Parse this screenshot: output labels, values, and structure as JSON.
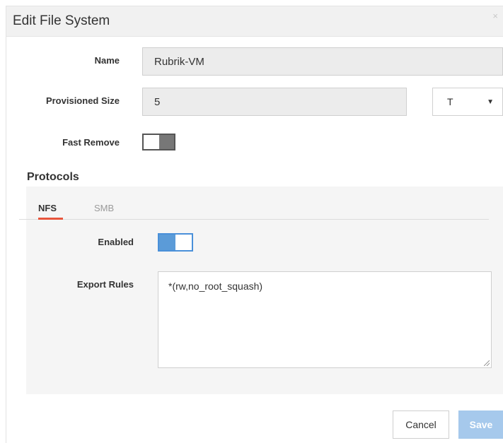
{
  "dialog": {
    "title": "Edit File System",
    "close_icon": "×"
  },
  "form": {
    "name_label": "Name",
    "name_value": "Rubrik-VM",
    "size_label": "Provisioned Size",
    "size_value": "5",
    "size_unit": "T",
    "fast_remove_label": "Fast Remove",
    "fast_remove_enabled": false
  },
  "protocols": {
    "title": "Protocols",
    "tabs": [
      {
        "label": "NFS",
        "active": true
      },
      {
        "label": "SMB",
        "active": false
      }
    ],
    "enabled_label": "Enabled",
    "enabled": true,
    "export_rules_label": "Export Rules",
    "export_rules_value": "*(rw,no_root_squash)"
  },
  "buttons": {
    "cancel": "Cancel",
    "save": "Save"
  },
  "colors": {
    "tab_accent": "#e8553c",
    "toggle_on": "#5b9bd8",
    "save_disabled": "#a6c9ec"
  }
}
